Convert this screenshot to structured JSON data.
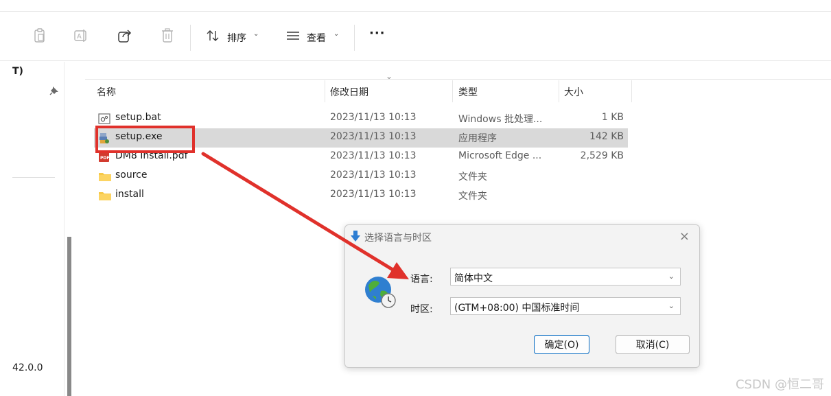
{
  "toolbar": {
    "sort_label": "排序",
    "view_label": "查看",
    "more_label": "···",
    "chevron": "⌄"
  },
  "nav": {
    "top_text": "T)",
    "bottom_text": "42.0.0"
  },
  "columns": {
    "name": "名称",
    "date": "修改日期",
    "type": "类型",
    "size": "大小",
    "sort_indicator": "⌄"
  },
  "files": [
    {
      "name": "setup.bat",
      "date": "2023/11/13 10:13",
      "type": "Windows 批处理...",
      "size": "1 KB",
      "icon": "batch-file-icon"
    },
    {
      "name": "setup.exe",
      "date": "2023/11/13 10:13",
      "type": "应用程序",
      "size": "142 KB",
      "icon": "installer-exe-icon"
    },
    {
      "name": "DM8 Install.pdf",
      "date": "2023/11/13 10:13",
      "type": "Microsoft Edge ...",
      "size": "2,529 KB",
      "icon": "pdf-file-icon"
    },
    {
      "name": "source",
      "date": "2023/11/13 10:13",
      "type": "文件夹",
      "size": "",
      "icon": "folder-icon"
    },
    {
      "name": "install",
      "date": "2023/11/13 10:13",
      "type": "文件夹",
      "size": "",
      "icon": "folder-icon"
    }
  ],
  "dialog": {
    "title": "选择语言与时区",
    "close": "×",
    "language_label": "语言:",
    "language_value": "简体中文",
    "timezone_label": "时区:",
    "timezone_value": "(GTM+08:00) 中国标准时间",
    "ok_button": "确定(O)",
    "cancel_button": "取消(C)",
    "dropdown_arrow": "⌄"
  },
  "watermark": "CSDN @恒二哥",
  "colors": {
    "annotation_red": "#e0312b",
    "selection": "#d9d9d9",
    "accent_blue": "#0067c0"
  }
}
